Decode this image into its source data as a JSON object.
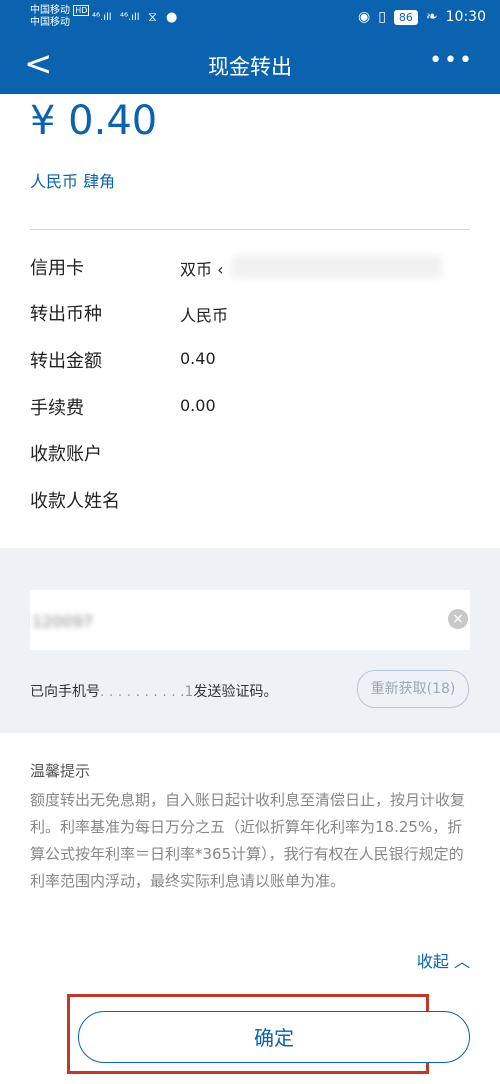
{
  "status_bar": {
    "carrier1": "中国移动",
    "hd": "HD",
    "carrier2": "中国移动",
    "sig1": "⁴⁶.ıll",
    "sig2": "⁴⁶.ıll",
    "battery": "86",
    "time": "10:30"
  },
  "navbar": {
    "back": "<",
    "title": "现金转出",
    "more": "•••"
  },
  "amount": {
    "value": "¥ 0.40",
    "cn": "人民币 肆角"
  },
  "details": [
    {
      "label": "信用卡",
      "value": "双币 ‹"
    },
    {
      "label": "转出币种",
      "value": "人民币"
    },
    {
      "label": "转出金额",
      "value": "0.40"
    },
    {
      "label": "手续费",
      "value": "0.00"
    },
    {
      "label": "收款账户",
      "value": ""
    },
    {
      "label": "收款人姓名",
      "value": ""
    }
  ],
  "verify": {
    "code_value": "120097",
    "sms_prefix": "已向手机号",
    "sms_masked": ". . . . . . . . . .1",
    "sms_suffix": "发送验证码。",
    "resend_label": "重新获取(18)"
  },
  "tips": {
    "title": "温馨提示",
    "text": "额度转出无免息期，自入账日起计收利息至清偿日止，按月计收复利。利率基准为每日万分之五（近似折算年化利率为18.25%，折算公式按年利率＝日利率*365计算），我行有权在人民银行规定的利率范围内浮动，最终实际利息请以账单为准。",
    "collapse": "收起 ︿"
  },
  "confirm_label": "确定"
}
